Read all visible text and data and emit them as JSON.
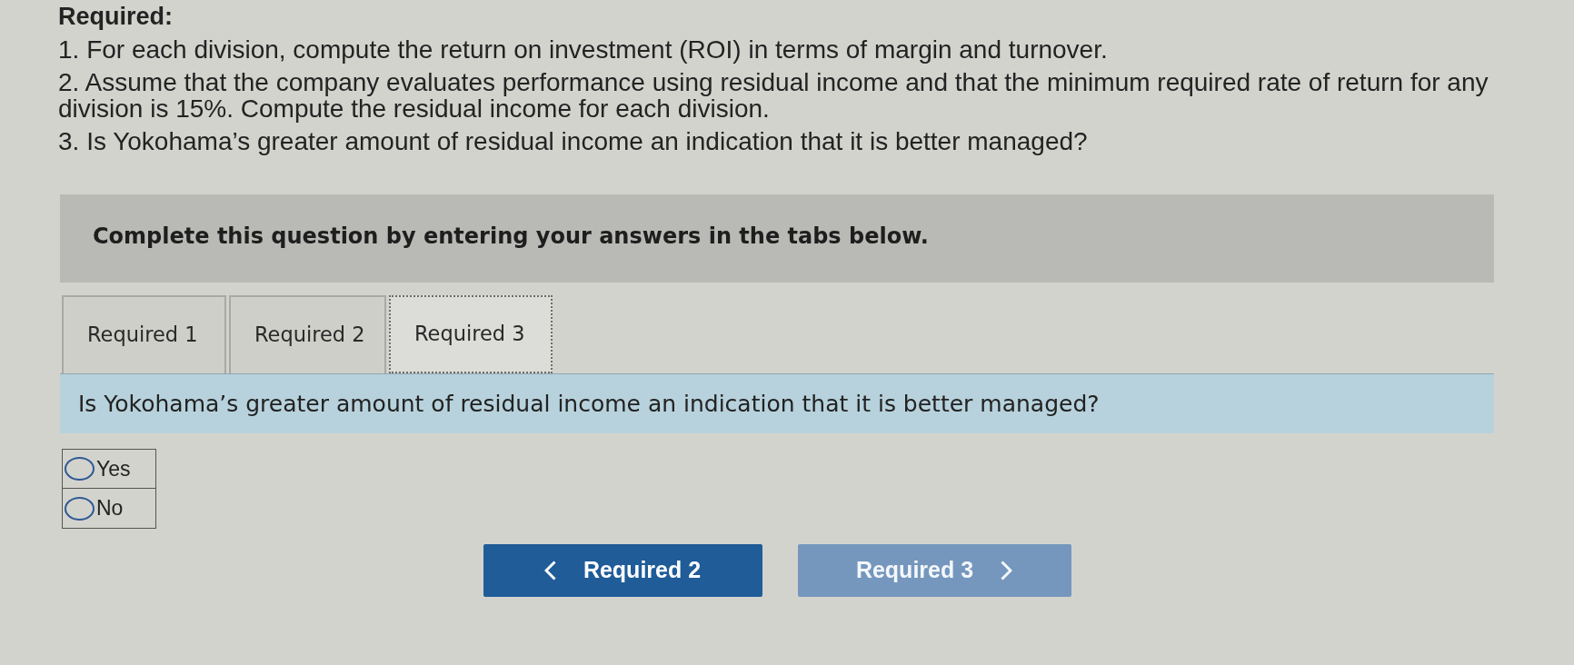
{
  "heading": "Required:",
  "requirements": [
    "1. For each division, compute the return on investment (ROI) in terms of margin and turnover.",
    "2. Assume that the company evaluates performance using residual income and that the minimum required rate of return for any division is 15%. Compute the residual income for each division.",
    "3. Is Yokohama’s greater amount of residual income an indication that it is better managed?"
  ],
  "instructions": "Complete this question by entering your answers in the tabs below.",
  "tabs": [
    {
      "label": "Required 1",
      "selected": false
    },
    {
      "label": "Required 2",
      "selected": false
    },
    {
      "label": "Required 3",
      "selected": true
    }
  ],
  "question": "Is Yokohama’s greater amount of residual income an indication that it is better managed?",
  "options": [
    {
      "label": "Yes",
      "selected": false
    },
    {
      "label": "No",
      "selected": false
    }
  ],
  "buttons": [
    {
      "kind": "previous",
      "label": "Required 2",
      "disabled": false
    },
    {
      "kind": "next",
      "label": "Required 3",
      "disabled": true
    }
  ]
}
